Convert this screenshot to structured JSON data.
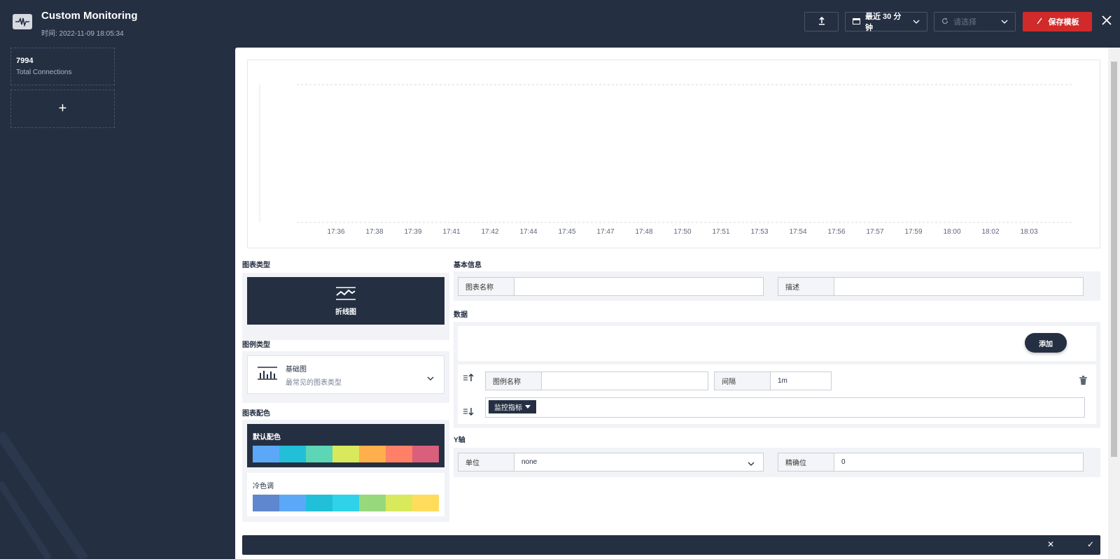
{
  "header": {
    "title": "Custom Monitoring",
    "time": "时间: 2022-11-09 18:05:34",
    "time_range": "最近 30 分钟",
    "refresh_placeholder": "请选择",
    "save_label": "保存模板",
    "icons": {
      "app": "monitor-icon",
      "upload": "upload-icon",
      "calendar": "calendar-icon",
      "refresh": "refresh-icon",
      "edit": "edit-icon",
      "close": "close-icon"
    }
  },
  "sidebar": {
    "stat": {
      "value": "7994",
      "label": "Total Connections"
    },
    "add_symbol": "+"
  },
  "preview": {
    "x_ticks": [
      "17:36",
      "17:38",
      "17:39",
      "17:41",
      "17:42",
      "17:44",
      "17:45",
      "17:47",
      "17:48",
      "17:50",
      "17:51",
      "17:53",
      "17:54",
      "17:56",
      "17:57",
      "17:59",
      "18:00",
      "18:02",
      "18:03"
    ]
  },
  "chart_type": {
    "section_title": "图表类型",
    "selected": "折线图"
  },
  "legend_type": {
    "section_title": "图例类型",
    "name": "基础图",
    "desc": "最常见的图表类型"
  },
  "chart_colors": {
    "section_title": "图表配色",
    "palettes": [
      {
        "name": "默认配色",
        "colors": [
          "#5ba8f8",
          "#22c0d8",
          "#5cd6b4",
          "#d8e95c",
          "#ffb04c",
          "#ff8066",
          "#d95f7c"
        ]
      },
      {
        "name": "冷色调",
        "colors": [
          "#5f87cf",
          "#5ba8f8",
          "#22c0d8",
          "#2fd2e8",
          "#98d87c",
          "#d8e95c",
          "#ffdc5c"
        ]
      }
    ]
  },
  "basic_info": {
    "section_title": "基本信息",
    "name_label": "图表名称",
    "name_value": "",
    "desc_label": "描述",
    "desc_value": ""
  },
  "data": {
    "section_title": "数据",
    "add_label": "添加",
    "legend_name_label": "图例名称",
    "legend_name_value": "",
    "interval_label": "间隔",
    "interval_value": "1m",
    "metric_label": "监控指标"
  },
  "y_axis": {
    "section_title": "Y轴",
    "unit_label": "单位",
    "unit_value": "none",
    "precision_label": "精确位",
    "precision_value": "0"
  },
  "bottom": {
    "cancel": "✕",
    "confirm": "✓"
  }
}
